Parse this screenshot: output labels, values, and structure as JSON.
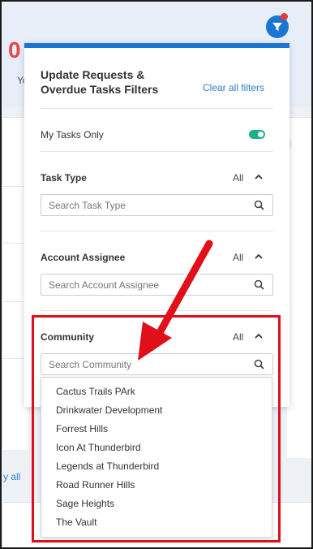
{
  "background": {
    "big_number": "0",
    "partial_text": "Yo",
    "view_all": "y all"
  },
  "filter_button": {
    "icon": "filter-icon",
    "color": "#1976d2",
    "badge_color": "#e53935"
  },
  "panel": {
    "title": "Update Requests & Overdue Tasks Filters",
    "clear_all": "Clear all filters",
    "my_tasks_only": {
      "label": "My Tasks Only",
      "enabled": true
    },
    "sections": {
      "task_type": {
        "label": "Task Type",
        "all": "All",
        "placeholder": "Search Task Type"
      },
      "account_assignee": {
        "label": "Account Assignee",
        "all": "All",
        "placeholder": "Search Account Assignee"
      },
      "community": {
        "label": "Community",
        "all": "All",
        "placeholder": "Search Community"
      }
    },
    "community_options": [
      "Cactus Trails PArk",
      "Drinkwater Development",
      "Forrest Hills",
      "Icon At Thunderbird",
      "Legends at Thunderbird",
      "Road Runner Hills",
      "Sage Heights",
      "The Vault"
    ]
  },
  "colors": {
    "accent": "#1976d2",
    "toggle_on": "#1bb18a",
    "annotation": "#e10f1a",
    "link": "#2d7fd0"
  }
}
